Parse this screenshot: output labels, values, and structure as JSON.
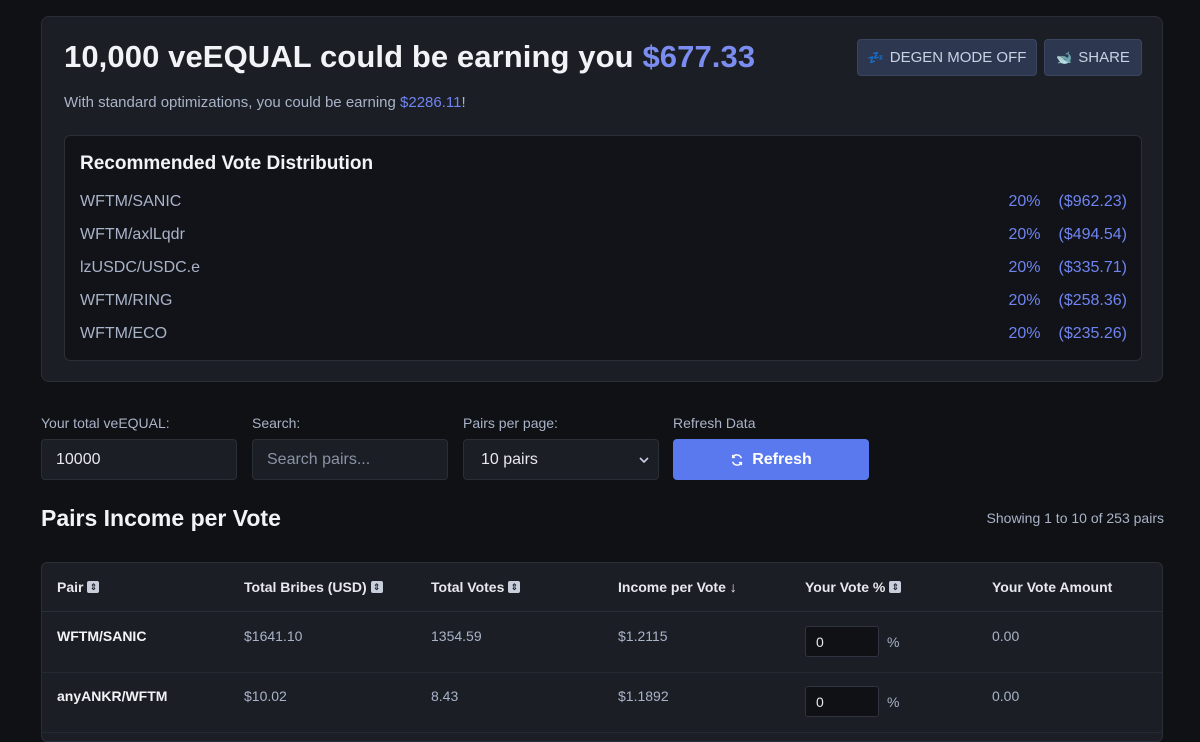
{
  "hero": {
    "title_prefix": "10,000 veEQUAL could be earning you ",
    "title_amount": "$677.33",
    "sub_prefix": "With standard optimizations, you could be earning ",
    "sub_amount": "$2286.11",
    "sub_suffix": "!",
    "degen_icon": "💤",
    "degen_label": "DEGEN MODE OFF",
    "share_icon": "🐋",
    "share_label": "SHARE"
  },
  "recommended": {
    "title": "Recommended Vote Distribution",
    "rows": [
      {
        "pair": "WFTM/SANIC",
        "pct": "20%",
        "value": "($962.23)"
      },
      {
        "pair": "WFTM/axlLqdr",
        "pct": "20%",
        "value": "($494.54)"
      },
      {
        "pair": "lzUSDC/USDC.e",
        "pct": "20%",
        "value": "($335.71)"
      },
      {
        "pair": "WFTM/RING",
        "pct": "20%",
        "value": "($258.36)"
      },
      {
        "pair": "WFTM/ECO",
        "pct": "20%",
        "value": "($235.26)"
      }
    ]
  },
  "controls": {
    "total_label": "Your total veEQUAL:",
    "total_value": "10000",
    "search_label": "Search:",
    "search_placeholder": "Search pairs...",
    "per_page_label": "Pairs per page:",
    "per_page_value": "10 pairs",
    "refresh_label": "Refresh Data",
    "refresh_button": "Refresh"
  },
  "section": {
    "title": "Pairs Income per Vote",
    "showing": "Showing 1 to 10 of 253 pairs"
  },
  "table": {
    "headers": {
      "pair": "Pair",
      "bribes": "Total Bribes (USD)",
      "votes": "Total Votes",
      "income": "Income per Vote ↓",
      "vote_pct": "Your Vote %",
      "vote_amount": "Your Vote Amount"
    },
    "rows": [
      {
        "pair": "WFTM/SANIC",
        "bribes": "$1641.10",
        "votes": "1354.59",
        "income": "$1.2115",
        "vote_pct": "0",
        "pct_sign": "%",
        "vote_amount": "0.00"
      },
      {
        "pair": "anyANKR/WFTM",
        "bribes": "$10.02",
        "votes": "8.43",
        "income": "$1.1892",
        "vote_pct": "0",
        "pct_sign": "%",
        "vote_amount": "0.00"
      }
    ]
  },
  "colors": {
    "accent": "#5b79ef",
    "highlight": "#7b8df0",
    "background": "#0f1114",
    "card": "#1b1e25"
  }
}
